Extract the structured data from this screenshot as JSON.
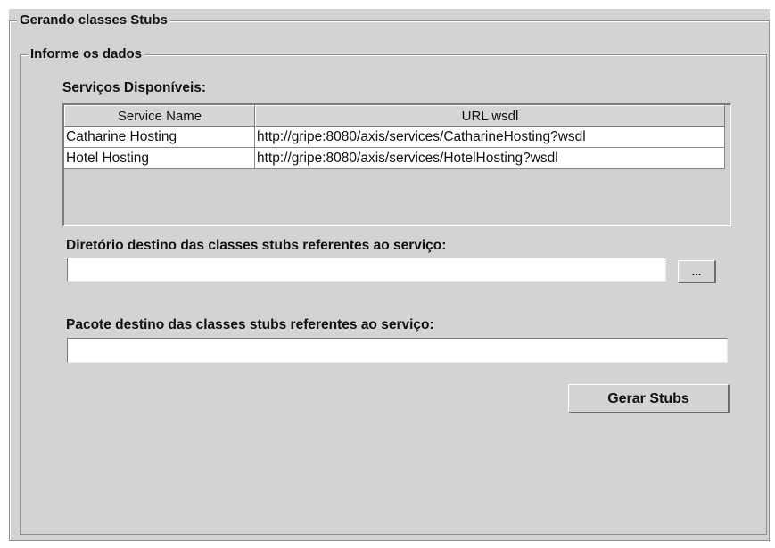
{
  "outer_group": {
    "title": "Gerando classes Stubs"
  },
  "inner_group": {
    "title": "Informe os dados"
  },
  "services": {
    "label": "Serviços Disponíveis:",
    "columns": [
      "Service Name",
      "URL wsdl"
    ],
    "rows": [
      [
        "Catharine Hosting",
        "http://gripe:8080/axis/services/CatharineHosting?wsdl"
      ],
      [
        "Hotel Hosting",
        "http://gripe:8080/axis/services/HotelHosting?wsdl"
      ]
    ]
  },
  "directory": {
    "label": "Diretório destino das classes stubs referentes ao serviço:",
    "value": "",
    "browse_label": "..."
  },
  "package": {
    "label": "Pacote destino das classes stubs referentes ao serviço:",
    "value": ""
  },
  "actions": {
    "generate_label": "Gerar Stubs"
  }
}
